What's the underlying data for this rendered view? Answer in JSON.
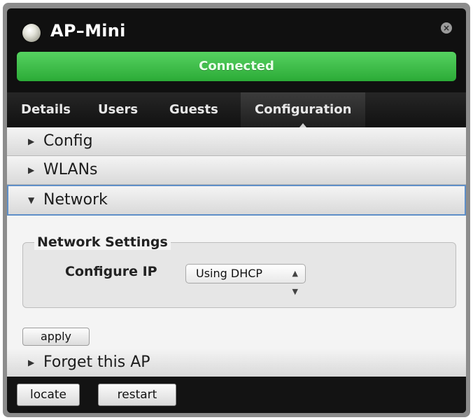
{
  "window": {
    "title": "AP–Mini",
    "close_glyph": "×",
    "status_text": "Connected",
    "status_color": "#3cc14a"
  },
  "tabs": [
    {
      "label": "Details",
      "active": false
    },
    {
      "label": "Users",
      "active": false
    },
    {
      "label": "Guests",
      "active": false
    },
    {
      "label": "Configuration",
      "active": true
    }
  ],
  "sections": {
    "config": {
      "label": "Config",
      "expanded": false
    },
    "wlans": {
      "label": "WLANs",
      "expanded": false
    },
    "network": {
      "label": "Network",
      "expanded": true
    },
    "forget": {
      "label": "Forget this AP",
      "expanded": false
    }
  },
  "network_settings": {
    "legend": "Network Settings",
    "configure_ip_label": "Configure IP",
    "configure_ip_value": "Using DHCP",
    "apply_label": "apply"
  },
  "footer": {
    "locate_label": "locate",
    "restart_label": "restart"
  },
  "icons": {
    "collapsed": "triangle-right-icon",
    "expanded": "triangle-down-icon",
    "select": "up-down-chevron-icon",
    "status": "status-led-icon",
    "close": "close-icon"
  }
}
